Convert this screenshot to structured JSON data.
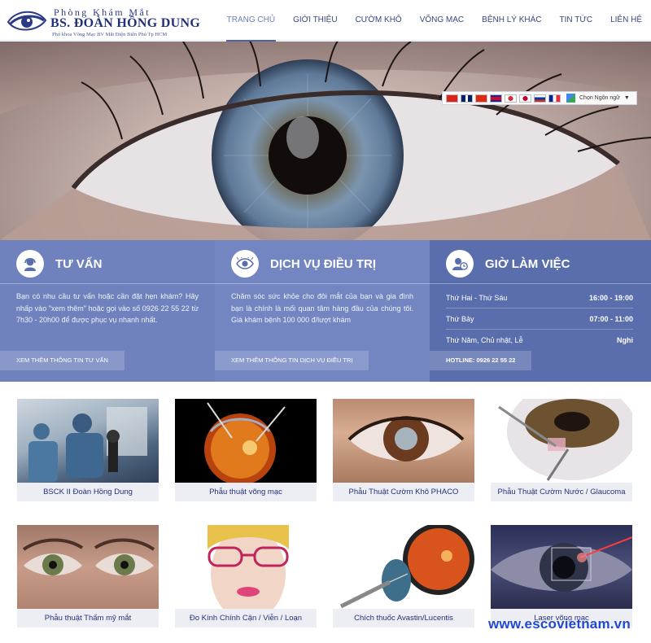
{
  "header": {
    "logo": {
      "top": "Phòng Khám Mắt",
      "main": "BS. ĐOÀN HỒNG DUNG",
      "sub": "Phó khoa Võng Mạc BV Mắt Điện Biên Phủ Tp HCM"
    },
    "nav": [
      {
        "label": "TRANG CHỦ",
        "active": true
      },
      {
        "label": "GIỚI THIỆU",
        "active": false
      },
      {
        "label": "CƯỜM KHÔ",
        "active": false
      },
      {
        "label": "VÕNG MẠC",
        "active": false
      },
      {
        "label": "BỆNH LÝ KHÁC",
        "active": false
      },
      {
        "label": "TIN TỨC",
        "active": false
      },
      {
        "label": "LIÊN HỆ",
        "active": false
      }
    ]
  },
  "language": {
    "flags": [
      "vn",
      "gb",
      "cn",
      "kh",
      "kr",
      "jp",
      "ru",
      "fr"
    ],
    "select_label": "Chọn Ngôn ngữ"
  },
  "info": {
    "consult": {
      "title": "TƯ VẤN",
      "icon": "headset-icon",
      "text": "Bạn có nhu cầu tư vấn hoặc cần đặt hẹn khám? Hãy nhấp vào \"xem thêm\" hoặc gọi vào số 0926 22 55 22 từ 7h30 - 20h00 để được phục vụ nhanh nhất.",
      "button": "XEM THÊM THÔNG TIN TƯ VẤN"
    },
    "service": {
      "title": "DỊCH VỤ ĐIỀU TRỊ",
      "icon": "eye-icon",
      "text": "Chăm sóc sức khỏe cho đôi mắt của bạn và gia đình bạn là chính là mối quan tâm hàng đầu của chúng tôi. Giá khám bệnh 100 000 đ/lượt khám",
      "button": "XEM THÊM THÔNG TIN DỊCH VỤ ĐIỀU TRỊ"
    },
    "hours": {
      "title": "GIỜ LÀM VIỆC",
      "icon": "clock-user-icon",
      "rows": [
        {
          "day": "Thứ Hai - Thứ Sáu",
          "time": "16:00 - 19:00"
        },
        {
          "day": "Thứ Bảy",
          "time": "07:00 - 11:00"
        },
        {
          "day": "Thứ Năm, Chủ nhật, Lễ",
          "time": "Nghỉ"
        }
      ],
      "hotline": "HOTLINE: 0926 22 55 22"
    }
  },
  "services": [
    {
      "caption": "BSCK II Đoàn Hồng Dung",
      "image": "surgeon-photo"
    },
    {
      "caption": "Phẫu thuật võng mạc",
      "image": "retina-illustration"
    },
    {
      "caption": "Phẫu Thuật Cườm Khô PHACO",
      "image": "cataract-eye-photo"
    },
    {
      "caption": "Phẫu Thuật Cườm Nước / Glaucoma",
      "image": "glaucoma-illustration"
    },
    {
      "caption": "Phẫu thuật Thẩm mỹ mắt",
      "image": "eyes-closeup-photo"
    },
    {
      "caption": "Đo Kính Chính Cận / Viễn / Loạn",
      "image": "woman-glasses-photo"
    },
    {
      "caption": "Chích thuốc Avastin/Lucentis",
      "image": "injection-illustration"
    },
    {
      "caption": "Laser võng mạc",
      "image": "laser-eye-photo"
    }
  ],
  "watermark": "www.escovietnam.vn"
}
